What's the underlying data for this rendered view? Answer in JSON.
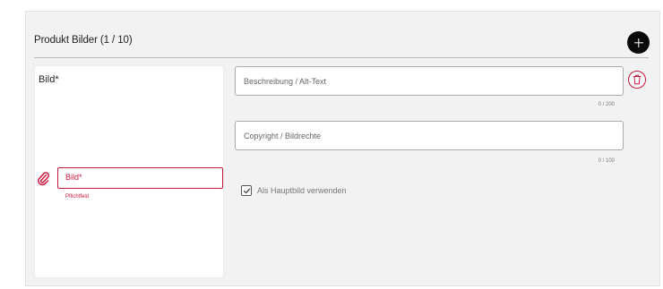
{
  "section": {
    "title": "Produkt Bilder (1 / 10)",
    "add_icon": "plus-icon"
  },
  "image_card": {
    "title": "Bild*",
    "attach_icon": "paperclip-icon",
    "field_label": "Bild*",
    "error_text": "Pflichtfeld"
  },
  "fields": {
    "description": {
      "placeholder": "Beschreibung / Alt-Text",
      "value": "",
      "counter": "0 / 200"
    },
    "copyright": {
      "placeholder": "Copyright / Bildrechte",
      "value": "",
      "counter": "0 / 100"
    }
  },
  "delete_icon": "trash-icon",
  "main_image_checkbox": {
    "label": "Als Hauptbild verwenden",
    "checked": true
  },
  "colors": {
    "error": "#c8193c",
    "panel": "#f2f2f2",
    "add_button": "#0a0a0a"
  }
}
